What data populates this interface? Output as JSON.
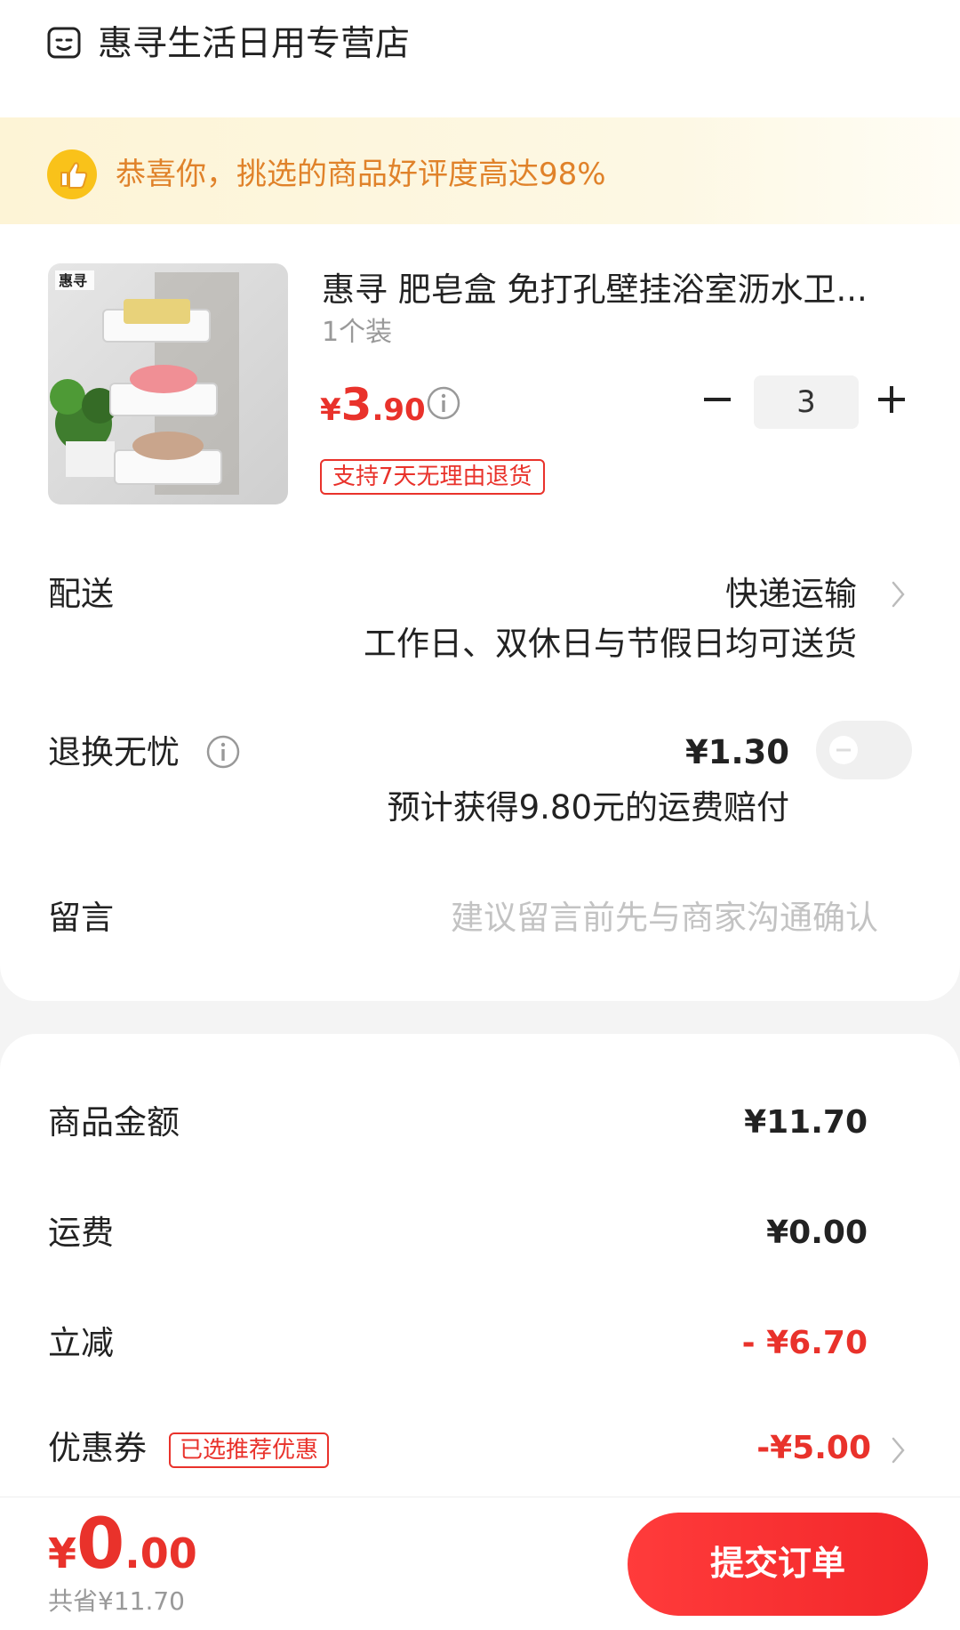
{
  "shop": {
    "name": "惠寻生活日用专营店"
  },
  "banner": {
    "text": "恭喜你，挑选的商品好评度高达98%"
  },
  "product": {
    "title": "惠寻 肥皂盒 免打孔壁挂浴室沥水卫...",
    "spec": "1个装",
    "price_symbol": "¥",
    "price_int": "3",
    "price_dec": ".90",
    "quantity": "3",
    "return_badge": "支持7天无理由退货"
  },
  "delivery": {
    "label": "配送",
    "method": "快递运输",
    "note": "工作日、双休日与节假日均可送货"
  },
  "return_insurance": {
    "label": "退换无忧",
    "price": "¥1.30",
    "note": "预计获得9.80元的运费赔付",
    "enabled": false
  },
  "message": {
    "label": "留言",
    "placeholder": "建议留言前先与商家沟通确认"
  },
  "summary": {
    "goods_label": "商品金额",
    "goods_value": "¥11.70",
    "shipping_label": "运费",
    "shipping_value": "¥0.00",
    "discount_label": "立减",
    "discount_value": "- ¥6.70",
    "coupon_label": "优惠券",
    "coupon_badge": "已选推荐优惠",
    "coupon_value": "-¥5.00"
  },
  "footer": {
    "total_symbol": "¥",
    "total_int": "0",
    "total_dec": ".00",
    "saved": "共省¥11.70",
    "submit_label": "提交订单"
  },
  "colors": {
    "accent": "#e9322b",
    "banner_text": "#e0822a",
    "banner_bg": "#fdf4d6"
  },
  "icons": [
    "shop-icon",
    "thumbs-up-icon",
    "info-icon",
    "minus-icon",
    "plus-icon",
    "chevron-right-icon"
  ]
}
